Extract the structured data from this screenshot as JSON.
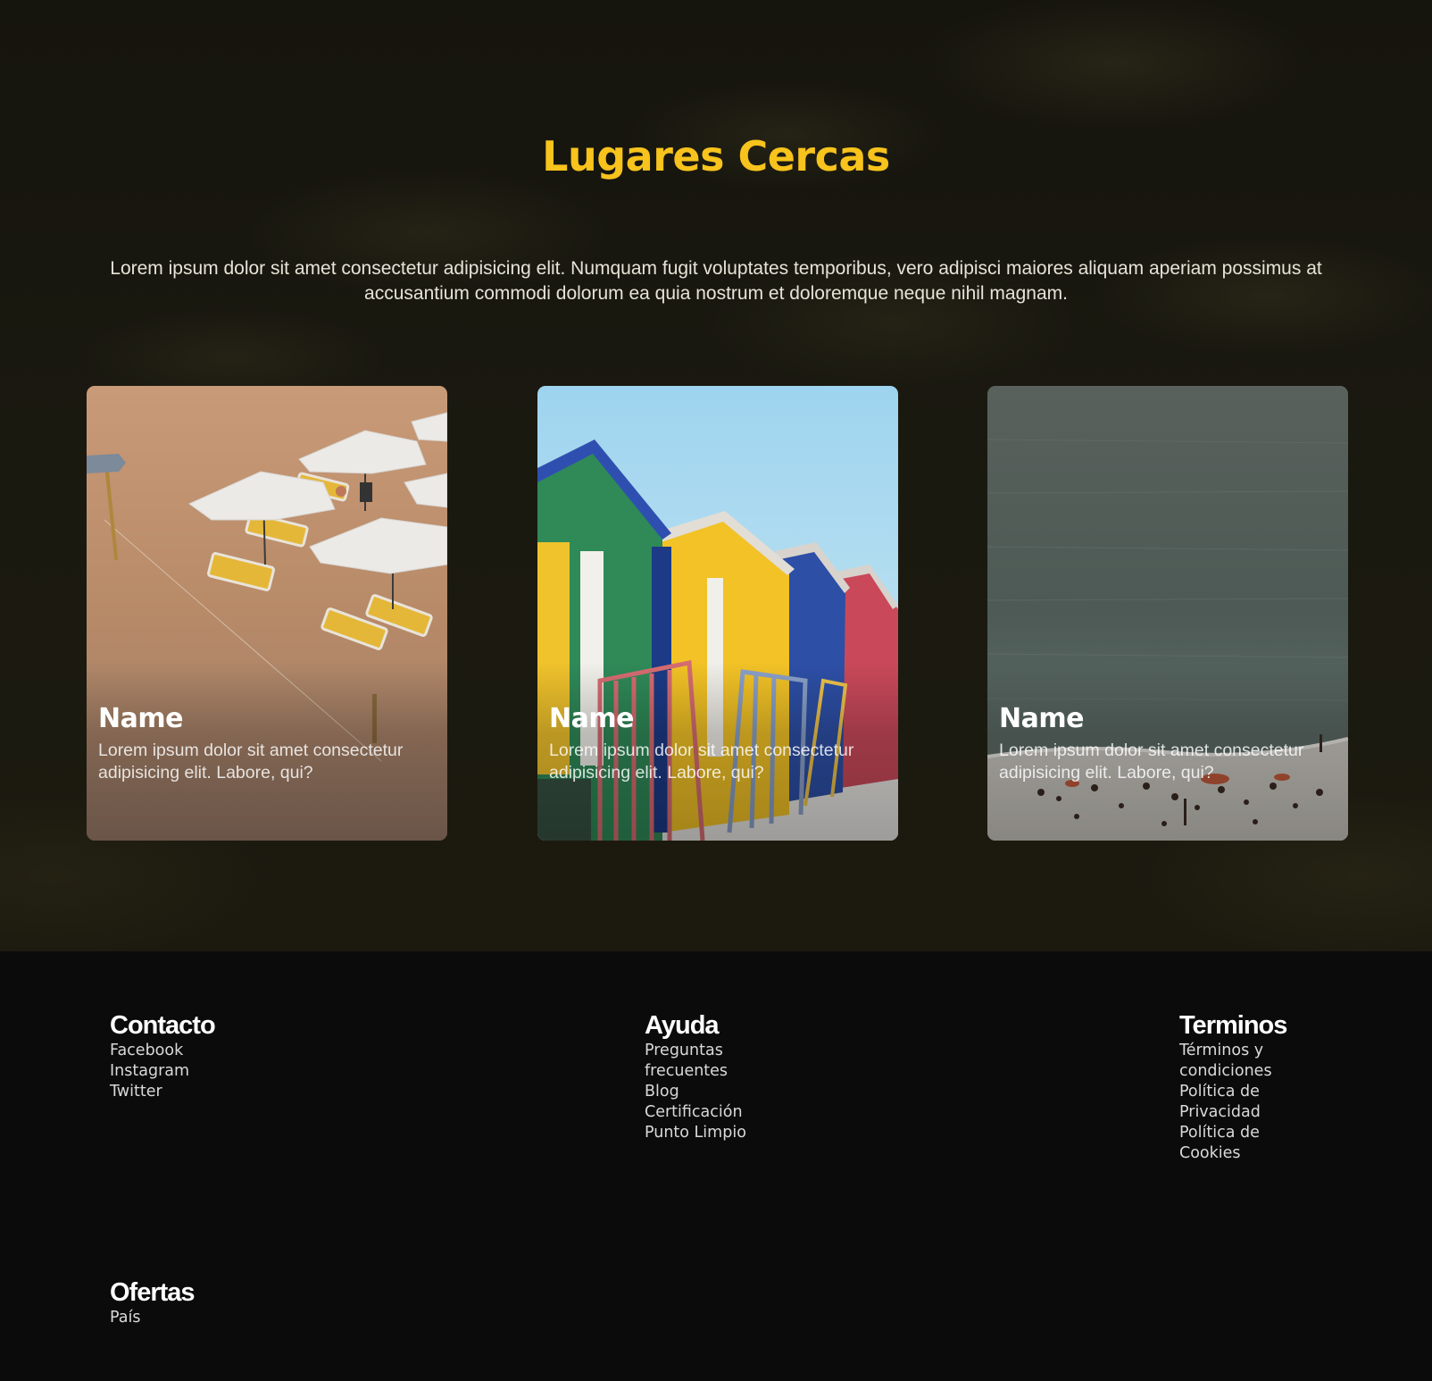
{
  "places": {
    "title": "Lugares Cercas",
    "description": "Lorem ipsum dolor sit amet consectetur adipisicing elit. Numquam fugit voluptates temporibus, vero adipisci maiores aliquam aperiam possimus at accusantium commodi dolorum ea quia nostrum et doloremque neque nihil magnam.",
    "cards": [
      {
        "name": "Name",
        "text": "Lorem ipsum dolor sit amet consectetur adipisicing elit. Labore, qui?",
        "image": "beach-umbrellas-photo"
      },
      {
        "name": "Name",
        "text": "Lorem ipsum dolor sit amet consectetur adipisicing elit. Labore, qui?",
        "image": "colorful-beach-huts-photo"
      },
      {
        "name": "Name",
        "text": "Lorem ipsum dolor sit amet consectetur adipisicing elit. Labore, qui?",
        "image": "sea-and-crowded-beach-photo"
      }
    ]
  },
  "footer": {
    "columns": [
      {
        "heading": "Contacto",
        "links": [
          "Facebook",
          "Instagram",
          "Twitter"
        ]
      },
      {
        "heading": "Ayuda",
        "links": [
          "Preguntas frecuentes",
          "Blog",
          "Certificación",
          "Punto Limpio"
        ]
      },
      {
        "heading": "Terminos",
        "links": [
          "Términos y condiciones",
          "Política de Privacidad",
          "Política de Cookies"
        ]
      },
      {
        "heading": "Ofertas",
        "links": [
          "País"
        ]
      }
    ]
  },
  "colors": {
    "accent": "#f7c31c",
    "section_background": "#1a1910",
    "footer_background": "#0b0b0b"
  }
}
